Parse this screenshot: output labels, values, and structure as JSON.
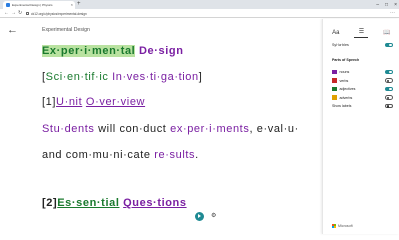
{
  "browser": {
    "tab_title": "Experimental Design | Physics",
    "tab_close": "×",
    "new_tab": "+",
    "url": "ck12.org/c/physics/experimental-design",
    "win_min": "–",
    "win_max": "□",
    "win_close": "×",
    "back_glyph": "←",
    "forward_glyph": "→",
    "reload_glyph": "↻",
    "more_glyph": "⋯"
  },
  "reader": {
    "back_glyph": "←",
    "doc_title": "Experimental Design",
    "lines": {
      "l1": [
        {
          "text": "Ex·per·i·men·tal",
          "pos": "adj"
        },
        {
          "text": " ",
          "pos": "plain"
        },
        {
          "text": "De·sign",
          "pos": "noun"
        }
      ],
      "l2": [
        {
          "text": "[",
          "pos": "plain"
        },
        {
          "text": "Sci·en·tif·ic",
          "pos": "adj"
        },
        {
          "text": " ",
          "pos": "plain"
        },
        {
          "text": "In·ves·ti·ga·tion",
          "pos": "noun"
        },
        {
          "text": "]",
          "pos": "plain"
        }
      ],
      "l3": [
        {
          "text": "[1]",
          "pos": "plain"
        },
        {
          "text": "U·nit",
          "pos": "noun"
        },
        {
          "text": " ",
          "pos": "plain"
        },
        {
          "text": "O·ver·view",
          "pos": "noun"
        }
      ],
      "l4": [
        {
          "text": "Stu·dents",
          "pos": "noun"
        },
        {
          "text": " will con·duct ",
          "pos": "plain"
        },
        {
          "text": "ex·per·i·ments",
          "pos": "noun"
        },
        {
          "text": ", e·val·u·",
          "pos": "plain"
        }
      ],
      "l5": [
        {
          "text": "and com·mu·ni·cate ",
          "pos": "plain"
        },
        {
          "text": "re·sults",
          "pos": "noun"
        },
        {
          "text": ".",
          "pos": "plain"
        }
      ],
      "l6": [
        {
          "text": "[2]",
          "pos": "plain"
        },
        {
          "text": "Es·sen·tial",
          "pos": "adj"
        },
        {
          "text": " ",
          "pos": "plain"
        },
        {
          "text": "Ques·tions",
          "pos": "noun"
        }
      ]
    },
    "play_label": "",
    "voice_glyph": "⚙"
  },
  "panel": {
    "tab_text_glyph": "Aa",
    "tab_grammar_glyph": "☰",
    "tab_reading_glyph": "📖",
    "syllables_label": "Syl·la·bles",
    "parts_heading": "Parts of Speech",
    "items": [
      {
        "label": "nouns",
        "color": "#7a1fa2",
        "on": true
      },
      {
        "label": "verbs",
        "color": "#c62828",
        "on": false
      },
      {
        "label": "adjectives",
        "color": "#1a7a2e",
        "on": true
      },
      {
        "label": "adverbs",
        "color": "#e0a100",
        "on": false
      }
    ],
    "show_labels": "Show labels",
    "brand": "Microsoft"
  },
  "colors": {
    "noun": "#7a1fa2",
    "adjective": "#1a7a2e",
    "highlight": "#b9e2a0",
    "accent": "#1f8a93"
  }
}
